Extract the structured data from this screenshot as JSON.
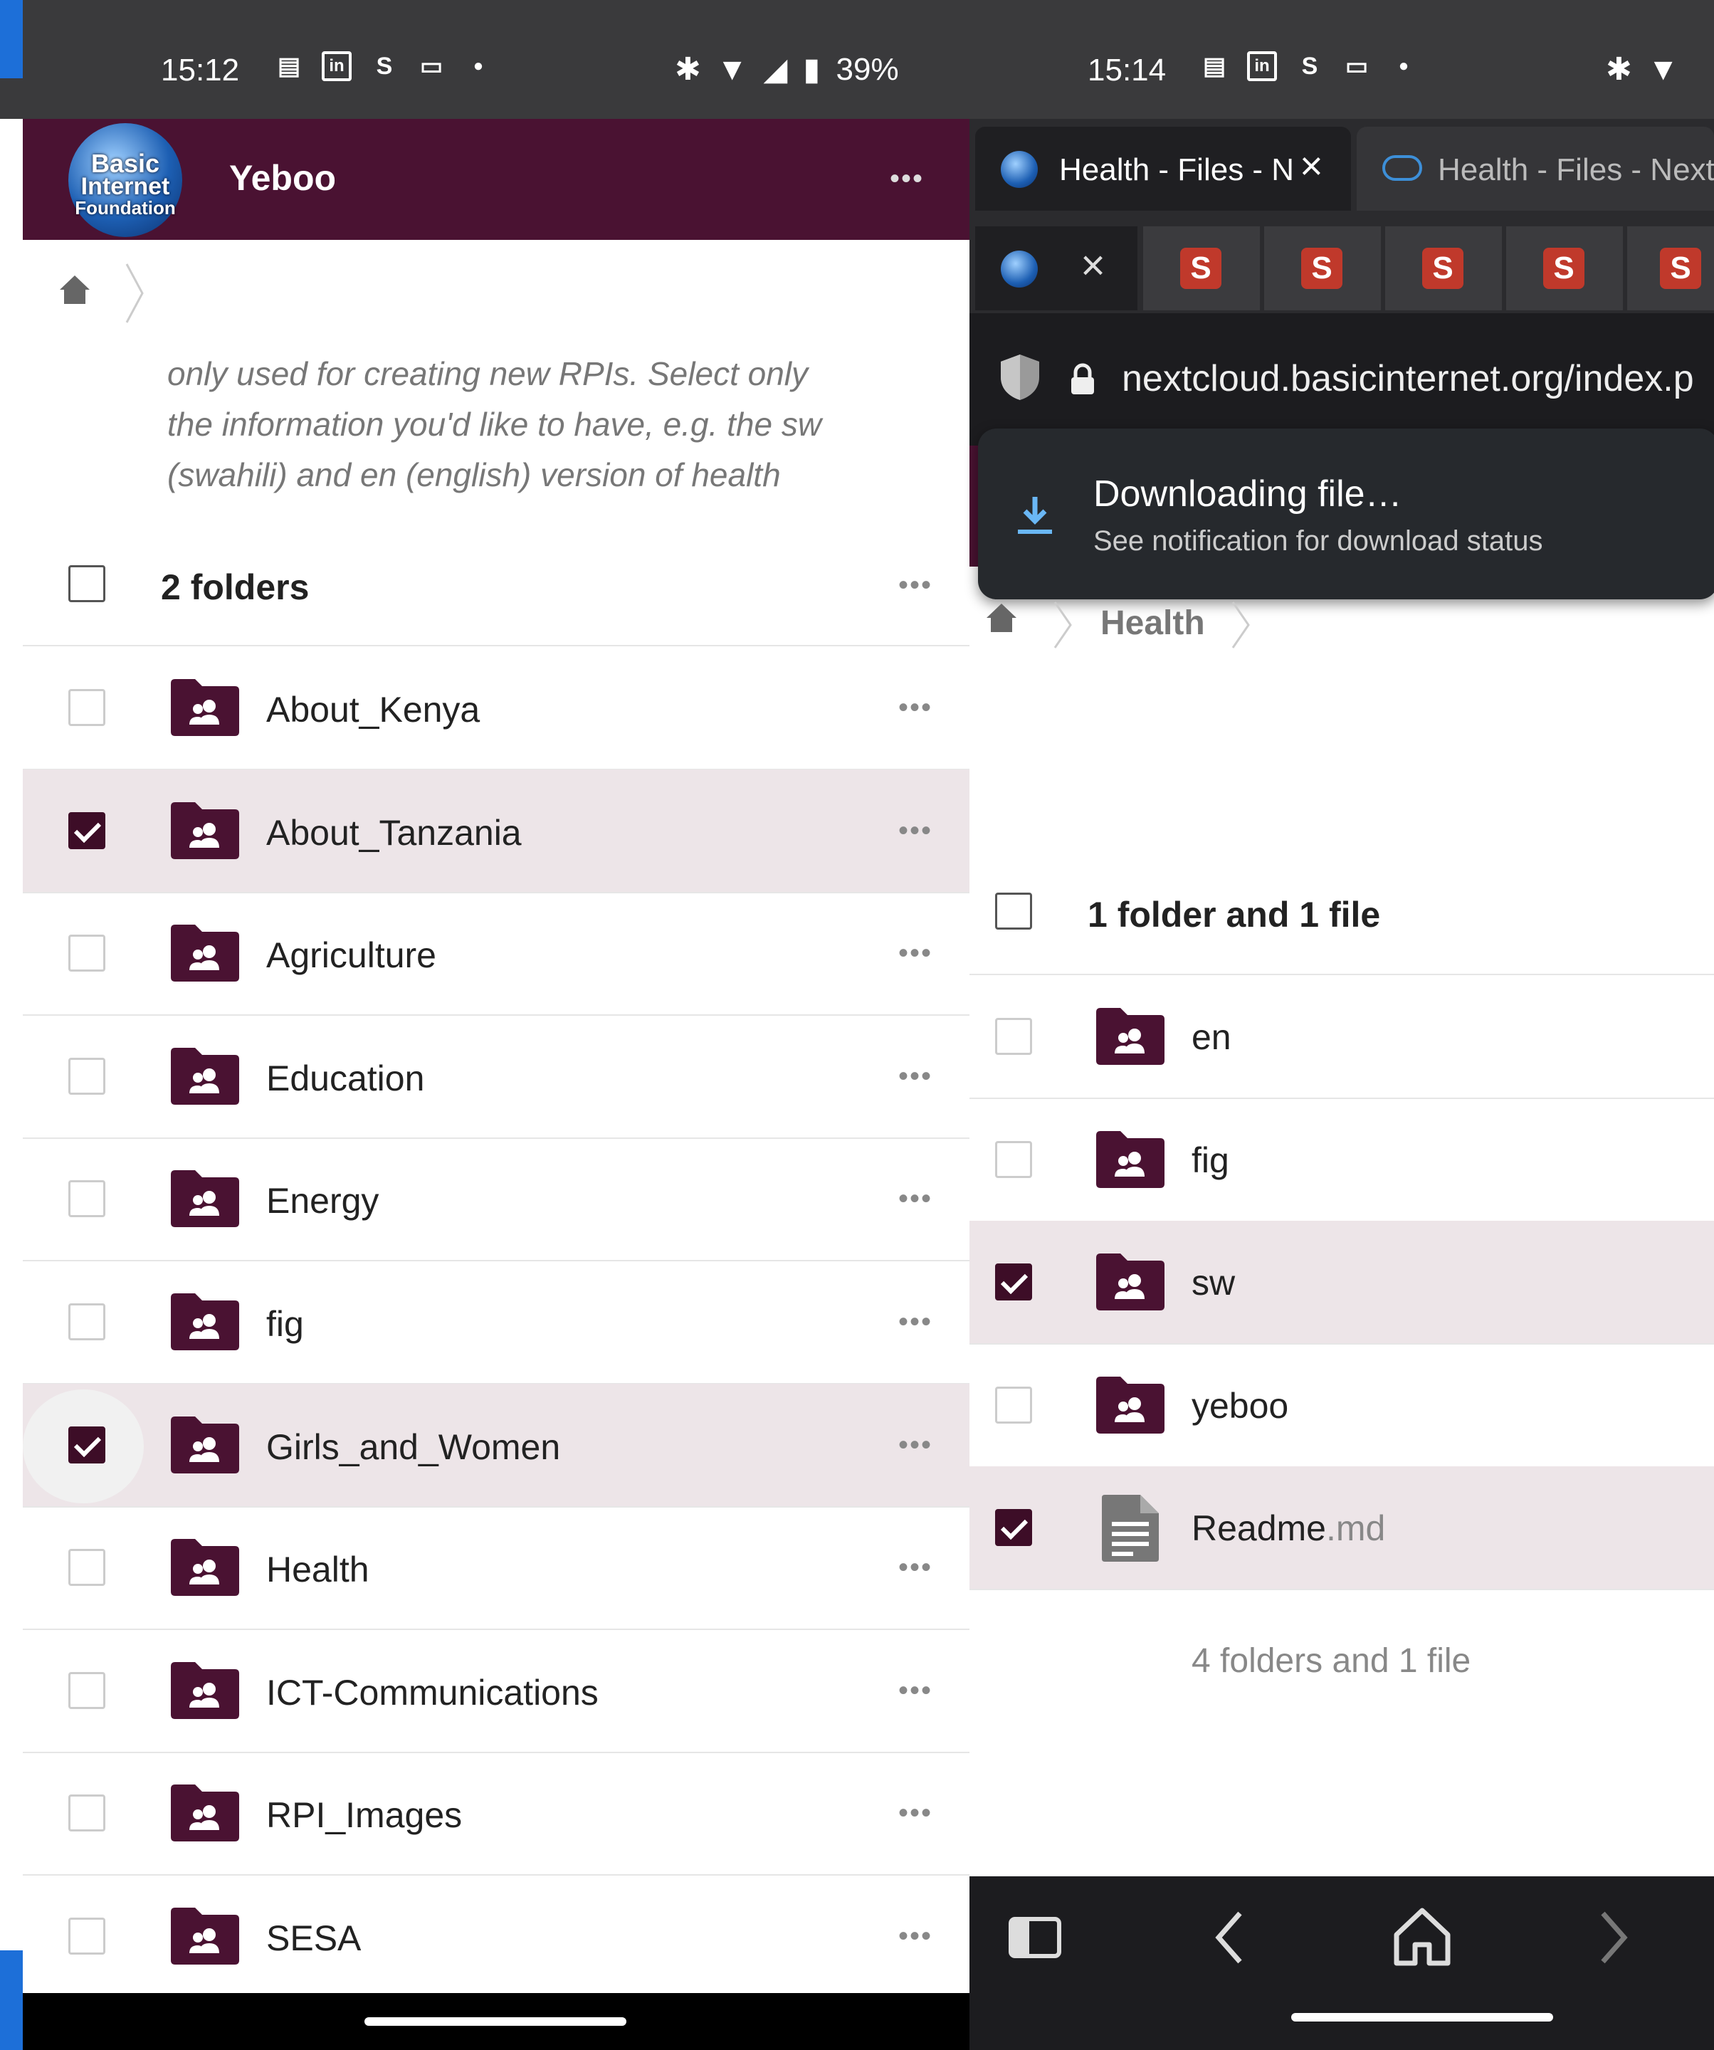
{
  "left_status": {
    "time": "15:12",
    "battery": "39%"
  },
  "right_status": {
    "time": "15:14"
  },
  "app": {
    "title": "Yeboo",
    "logo_line1": "Basic",
    "logo_line2": "Internet",
    "logo_line3": "Foundation",
    "menu": "•••"
  },
  "description": {
    "lines": [
      "only used for creating new RPIs. Select only",
      "the information you'd like to have, e.g. the sw",
      "(swahili) and en (english) version of health"
    ]
  },
  "left_list": {
    "count_label": "2 folders",
    "items": [
      {
        "name": "About_Kenya",
        "selected": false
      },
      {
        "name": "About_Tanzania",
        "selected": true
      },
      {
        "name": "Agriculture",
        "selected": false
      },
      {
        "name": "Education",
        "selected": false
      },
      {
        "name": "Energy",
        "selected": false
      },
      {
        "name": "fig",
        "selected": false
      },
      {
        "name": "Girls_and_Women",
        "selected": true
      },
      {
        "name": "Health",
        "selected": false
      },
      {
        "name": "ICT-Communications",
        "selected": false
      },
      {
        "name": "RPI_Images",
        "selected": false
      },
      {
        "name": "SESA",
        "selected": false
      }
    ]
  },
  "browser": {
    "tab1_title": "Health - Files - Ne",
    "tab2_title": "Health - Files - Next",
    "url": "nextcloud.basicinternet.org/index.p",
    "toast_title": "Downloading file…",
    "toast_sub": "See notification for download status"
  },
  "right_list": {
    "breadcrumb": "Health",
    "count_label": "1 folder and 1 file",
    "items": [
      {
        "name": "en",
        "ext": "",
        "type": "folder",
        "selected": false
      },
      {
        "name": "fig",
        "ext": "",
        "type": "folder",
        "selected": false
      },
      {
        "name": "sw",
        "ext": "",
        "type": "folder",
        "selected": true
      },
      {
        "name": "yeboo",
        "ext": "",
        "type": "folder",
        "selected": false
      },
      {
        "name": "Readme",
        "ext": ".md",
        "type": "file",
        "selected": true
      }
    ],
    "summary": "4 folders and 1 file"
  },
  "colors": {
    "brand": "#4a1232",
    "selected_row": "#ede5e8",
    "checkbox_on": "#3d0d27"
  }
}
